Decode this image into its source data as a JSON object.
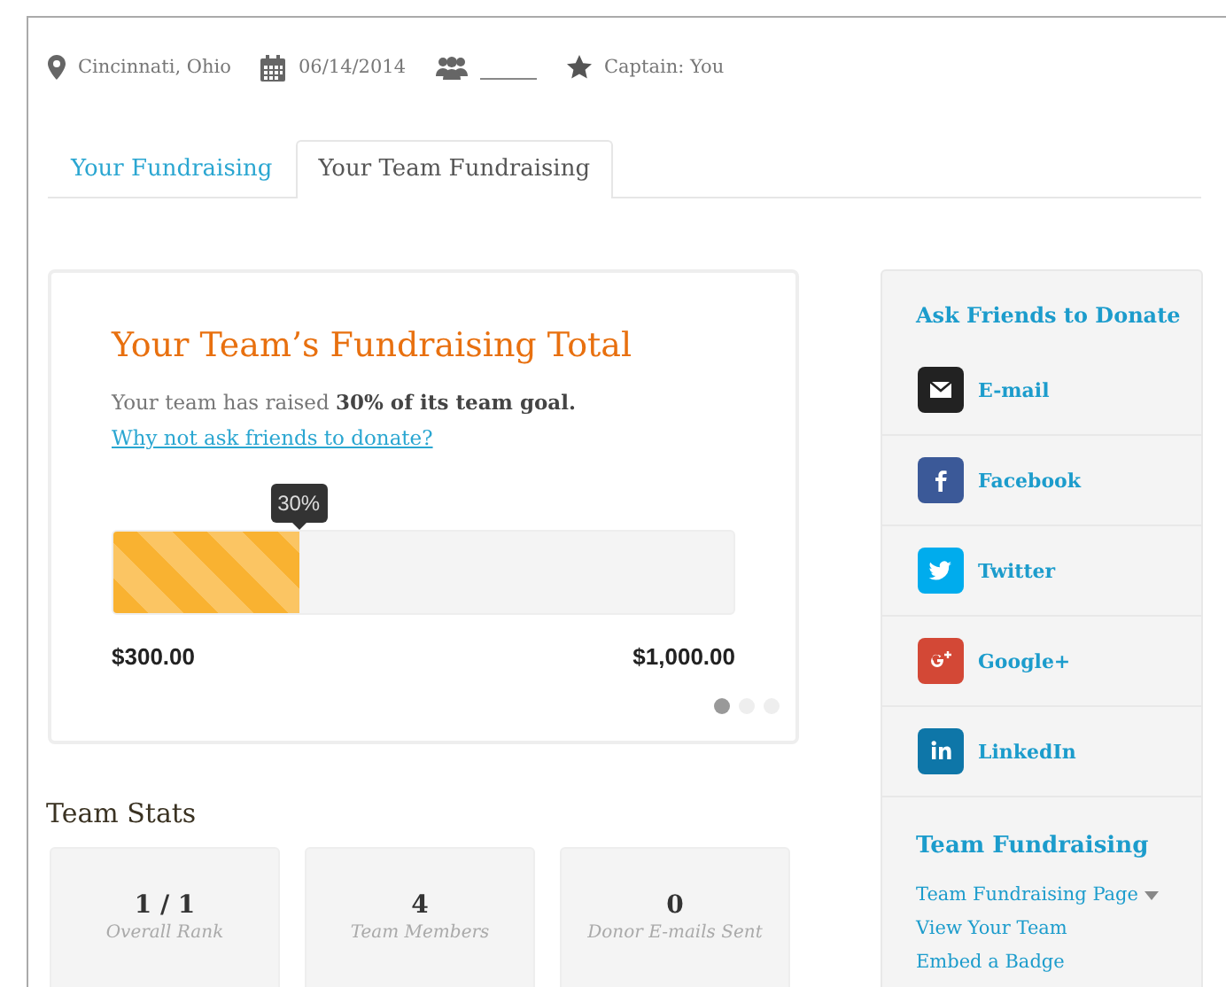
{
  "event_info": {
    "location": "Cincinnati, Ohio",
    "date": "06/14/2014",
    "captain": "Captain: You"
  },
  "tabs": [
    {
      "label": "Your Fundraising",
      "selected": false
    },
    {
      "label": "Your Team Fundraising",
      "selected": true
    }
  ],
  "progress_card": {
    "title": "Your Team’s Fundraising Total",
    "summary": "Your team has raised **30% of its team goal.**",
    "link": "Why not ask friends to donate?",
    "tooltip": "30%",
    "level": 0.3,
    "raised": "$300.00",
    "goal": "$1,000.00",
    "carousel_dots": [
      {
        "selected": true
      },
      {
        "selected": false
      },
      {
        "selected": false
      }
    ]
  },
  "team_stats": {
    "heading": "Team Stats",
    "stats": [
      {
        "value": "1 / 1",
        "label": "Overall Rank"
      },
      {
        "value": "4",
        "label": "Team Members"
      },
      {
        "value": "0",
        "label": "Donor E-mails Sent"
      }
    ]
  },
  "sidebar": {
    "ask_heading": "Ask Friends to Donate",
    "share_items": [
      {
        "kind": "email",
        "label": "E-mail"
      },
      {
        "kind": "facebook",
        "label": "Facebook"
      },
      {
        "kind": "twitter",
        "label": "Twitter"
      },
      {
        "kind": "googleplus",
        "label": "Google+"
      },
      {
        "kind": "linkedin",
        "label": "LinkedIn"
      }
    ],
    "team_heading": "Team Fundraising",
    "team_links": [
      {
        "label": "Team Fundraising Page",
        "dropdown": true
      },
      {
        "label": "View Your Team",
        "dropdown": false
      },
      {
        "label": "Embed a Badge",
        "dropdown": false
      }
    ]
  }
}
